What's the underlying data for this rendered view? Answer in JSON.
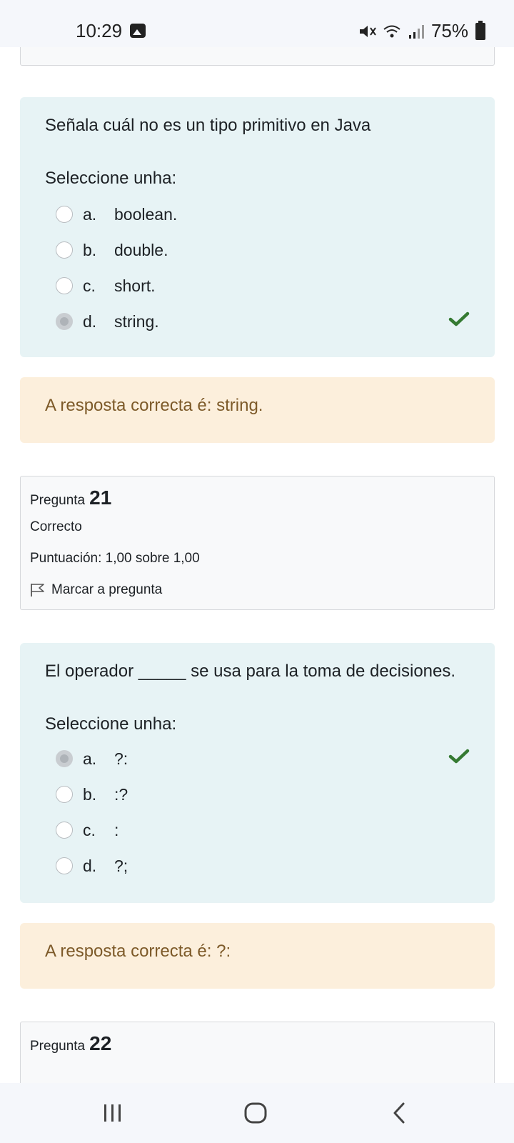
{
  "status_bar": {
    "time": "10:29",
    "battery": "75%",
    "icons": [
      "gallery-icon",
      "mute-icon",
      "wifi-icon",
      "signal-icon",
      "battery-icon"
    ]
  },
  "question_20": {
    "text": "Señala cuál no es un tipo primitivo en Java",
    "select_label": "Seleccione unha:",
    "options": [
      {
        "letter": "a.",
        "text": "boolean.",
        "selected": false,
        "correct": false
      },
      {
        "letter": "b.",
        "text": "double.",
        "selected": false,
        "correct": false
      },
      {
        "letter": "c.",
        "text": "short.",
        "selected": false,
        "correct": false
      },
      {
        "letter": "d.",
        "text": "string.",
        "selected": true,
        "correct": true
      }
    ],
    "feedback": "A resposta correcta é: string."
  },
  "question_21": {
    "label": "Pregunta",
    "number": "21",
    "state": "Correcto",
    "grade": "Puntuación: 1,00 sobre 1,00",
    "flag_label": "Marcar a pregunta",
    "text": "El operador _____ se usa para la toma de decisiones.",
    "select_label": "Seleccione unha:",
    "options": [
      {
        "letter": "a.",
        "text": "?:",
        "selected": true,
        "correct": true
      },
      {
        "letter": "b.",
        "text": ":?",
        "selected": false,
        "correct": false
      },
      {
        "letter": "c.",
        "text": ":",
        "selected": false,
        "correct": false
      },
      {
        "letter": "d.",
        "text": "?;",
        "selected": false,
        "correct": false
      }
    ],
    "feedback": "A resposta correcta é: ?:"
  },
  "question_22": {
    "label": "Pregunta",
    "number": "22"
  },
  "colors": {
    "question_bg": "#e7f3f5",
    "feedback_bg": "#fcefdc",
    "feedback_text": "#7d5a29",
    "check_green": "#357a32"
  }
}
